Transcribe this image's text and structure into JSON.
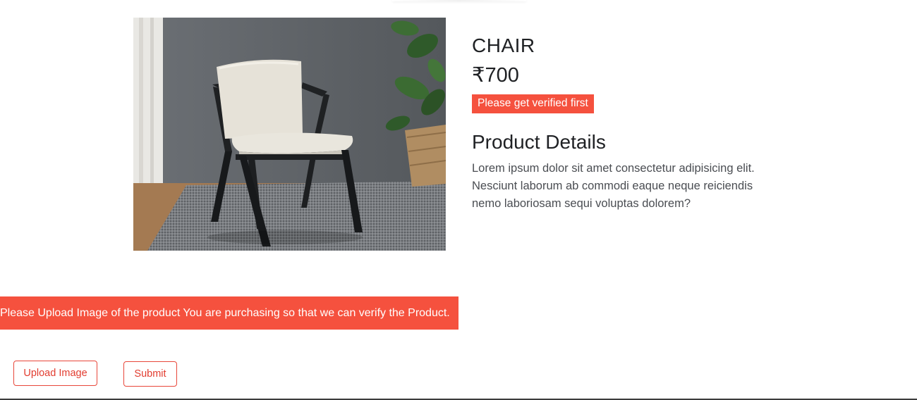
{
  "product": {
    "name": "CHAIR",
    "price": "₹700",
    "verification_status": "Please get verified first",
    "details_heading": "Product Details",
    "details_text": "Lorem ipsum dolor sit amet consectetur adipisicing elit. Nesciunt laborum ab commodi eaque neque reiciendis nemo laboriosam sequi voluptas dolorem?"
  },
  "verification": {
    "banner_text": "Please Upload Image of the product You are purchasing so that we can verify the Product.",
    "upload_label": "Upload Image",
    "submit_label": "Submit"
  },
  "colors": {
    "accent": "#f5513e",
    "button_text": "#e23c2f"
  }
}
